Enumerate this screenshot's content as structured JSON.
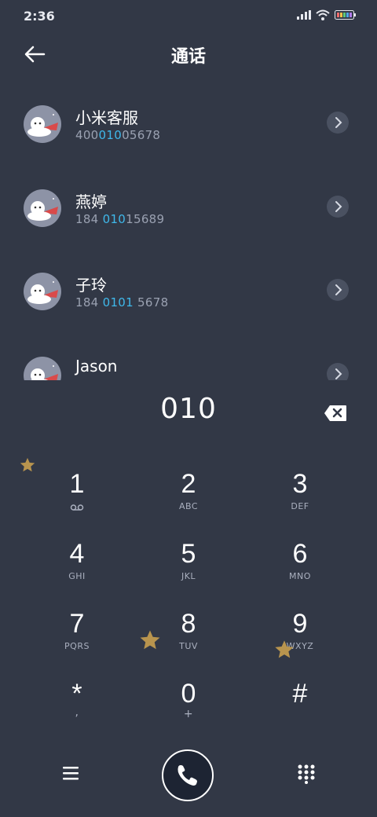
{
  "status_bar": {
    "time": "2:36"
  },
  "header": {
    "title": "通话"
  },
  "contacts": [
    {
      "name": "小米客服",
      "num_pre": "400",
      "num_hl": "010",
      "num_post": "05678"
    },
    {
      "name": "燕婷",
      "num_pre": "184 ",
      "num_hl": "010",
      "num_post": "15689"
    },
    {
      "name": "子玲",
      "num_pre": "184 ",
      "num_hl": "0101",
      "num_post": " 5678"
    },
    {
      "name": "Jason",
      "num_pre": "",
      "num_hl": "",
      "num_post": ""
    }
  ],
  "dial_entry": "010",
  "keypad": [
    {
      "digit": "1",
      "letters": ""
    },
    {
      "digit": "2",
      "letters": "ABC"
    },
    {
      "digit": "3",
      "letters": "DEF"
    },
    {
      "digit": "4",
      "letters": "GHI"
    },
    {
      "digit": "5",
      "letters": "JKL"
    },
    {
      "digit": "6",
      "letters": "MNO"
    },
    {
      "digit": "7",
      "letters": "PQRS"
    },
    {
      "digit": "8",
      "letters": "TUV"
    },
    {
      "digit": "9",
      "letters": "WXYZ"
    },
    {
      "digit": "*",
      "letters": ","
    },
    {
      "digit": "0",
      "letters": "+"
    },
    {
      "digit": "#",
      "letters": ""
    }
  ],
  "colors": {
    "background": "#323846",
    "highlight": "#3fb8ea",
    "star": "#b8944e"
  }
}
